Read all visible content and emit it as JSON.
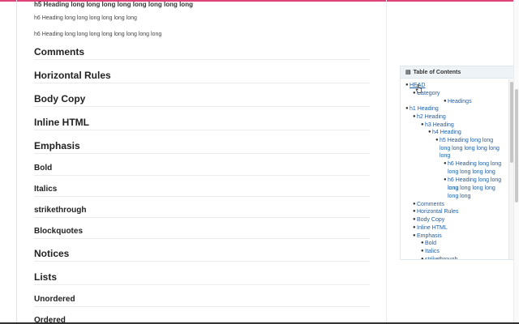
{
  "headings": {
    "h5": "h5 Heading long long long long long long long long",
    "h6a": "h6 Heading long long long long long long",
    "h6b": "h6 Heading long long long long long long long long"
  },
  "sections": [
    "Comments",
    "Horizontal Rules",
    "Body Copy",
    "Inline HTML",
    "Emphasis",
    "Bold",
    "Italics",
    "strikethrough",
    "Blockquotes",
    "Notices",
    "Lists",
    "Unordered",
    "Ordered"
  ],
  "toc": {
    "title": "Table of Contents",
    "icon": "list-icon",
    "items": [
      "HEAD",
      "Category",
      "Headings",
      "h1 Heading",
      "h2 Heading",
      "h3 Heading",
      "h4 Heading",
      "h5 Heading long long",
      "long long long long long",
      "long",
      "h6 Heading long long",
      "long long long long",
      "h6 Heading long long long",
      "long long long long",
      "long long",
      "Comments",
      "Horizontal Rules",
      "Body Copy",
      "Inline HTML",
      "Emphasis",
      "Bold",
      "Italics",
      "strikethrough"
    ]
  },
  "colors": {
    "accent": "#e0427a",
    "link": "#1c5fa8"
  }
}
